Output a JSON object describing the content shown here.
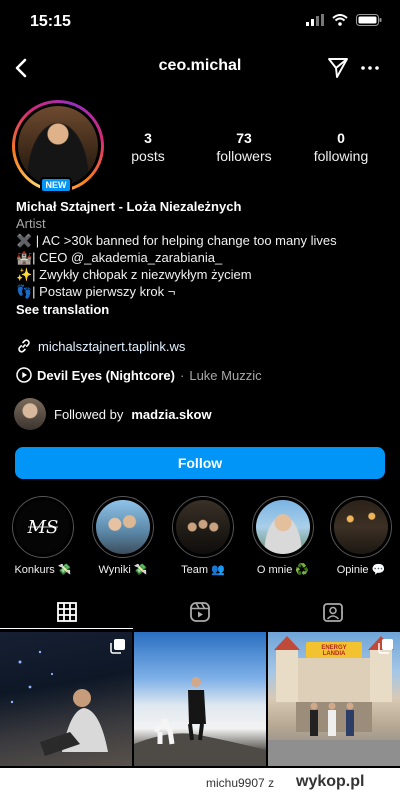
{
  "status_bar": {
    "time": "15:15"
  },
  "header": {
    "username": "ceo.michal"
  },
  "profile": {
    "badge": "NEW",
    "stats": [
      {
        "value": "3",
        "label": "posts"
      },
      {
        "value": "73",
        "label": "followers"
      },
      {
        "value": "0",
        "label": "following"
      }
    ],
    "name": "Michał Sztajnert - Loża Niezależnych",
    "category": "Artist",
    "bio_lines": [
      "✖️ | AC >30k banned for helping change too many lives",
      "🏰| CEO @_akademia_zarabiania_",
      "✨| Zwykły chłopak z niezwykłym życiem",
      "👣| Postaw pierwszy krok ¬"
    ],
    "see_translation": "See translation",
    "link": "michalsztajnert.taplink.ws",
    "music": {
      "song": "Devil Eyes (Nightcore)",
      "separator": "·",
      "artist": "Luke Muzzic"
    },
    "followed_by": {
      "prefix": "Followed by",
      "user": "madzia.skow"
    },
    "follow_button": "Follow"
  },
  "highlights": [
    {
      "label": "Konkurs 💸",
      "icon": "ms-logo"
    },
    {
      "label": "Wyniki 💸",
      "icon": "people-photo"
    },
    {
      "label": "Team 👥",
      "icon": "group-photo"
    },
    {
      "label": "O mnie ♻️",
      "icon": "portrait-photo"
    },
    {
      "label": "Opinie 💬",
      "icon": "evening-photo"
    }
  ],
  "tabs": [
    {
      "name": "grid",
      "icon": "grid-icon",
      "active": true
    },
    {
      "name": "reels",
      "icon": "reels-icon",
      "active": false
    },
    {
      "name": "tagged",
      "icon": "tagged-icon",
      "active": false
    }
  ],
  "posts": [
    {
      "icon": "multi-photo-icon",
      "scene": "man in night interior"
    },
    {
      "icon": "none",
      "scene": "man with dog on mountain above clouds"
    },
    {
      "icon": "multi-photo-icon",
      "scene": "group at Energylandia",
      "sign": "ENERGY LANDIA"
    }
  ],
  "watermark": {
    "user": "michu9907",
    "suffix": "z",
    "brand": "wykop.pl"
  },
  "colors": {
    "accent": "#0095f6",
    "background": "#000000",
    "muted": "#a8a8a8"
  }
}
